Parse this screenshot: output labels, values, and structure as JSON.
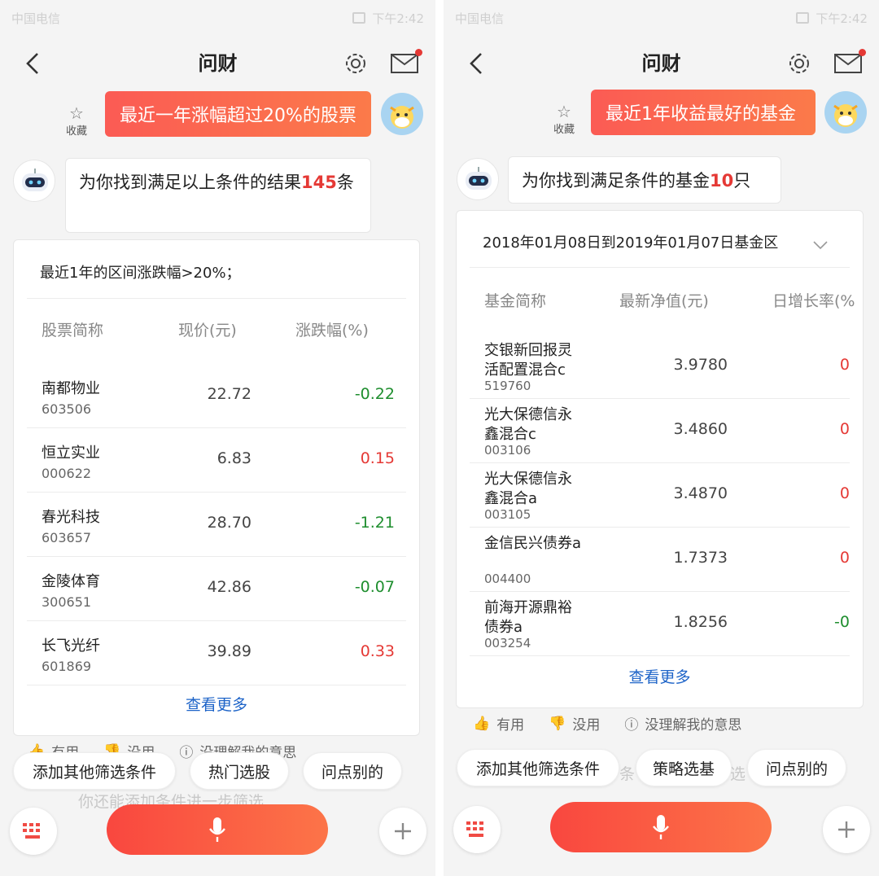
{
  "left": {
    "status": {
      "carrier": "中国电信",
      "time": "下午2:42"
    },
    "title": "问财",
    "favorite_label": "收藏",
    "question": "最近一年涨幅超过20%的股票",
    "answer_prefix": "为你找到满足以上条件的结果",
    "answer_count": "145",
    "answer_suffix": "条",
    "condition": "最近1年的区间涨跌幅>20%；",
    "headers": [
      "股票简称",
      "现价(元)",
      "涨跌幅(%)"
    ],
    "rows": [
      {
        "name": "南都物业",
        "code": "603506",
        "price": "22.72",
        "change": "-0.22",
        "dir": "down"
      },
      {
        "name": "恒立实业",
        "code": "000622",
        "price": "6.83",
        "change": "0.15",
        "dir": "up"
      },
      {
        "name": "春光科技",
        "code": "603657",
        "price": "28.70",
        "change": "-1.21",
        "dir": "down"
      },
      {
        "name": "金陵体育",
        "code": "300651",
        "price": "42.86",
        "change": "-0.07",
        "dir": "down"
      },
      {
        "name": "长飞光纤",
        "code": "601869",
        "price": "39.89",
        "change": "0.33",
        "dir": "up"
      }
    ],
    "more": "查看更多",
    "feedback": [
      "有用",
      "没用",
      "没理解我的意思"
    ],
    "chips": [
      "添加其他筛选条件",
      "热门选股",
      "问点别的"
    ],
    "ghost_hint": "你还能添加条件进一步筛选"
  },
  "right": {
    "status": {
      "carrier": "中国电信",
      "time": "下午2:42"
    },
    "title": "问财",
    "favorite_label": "收藏",
    "question": "最近1年收益最好的基金",
    "answer_prefix": "为你找到满足条件的基金",
    "answer_count": "10",
    "answer_suffix": "只",
    "range": "2018年01月08日到2019年01月07日基金区",
    "headers": [
      "基金简称",
      "最新净值(元)",
      "日增长率(%"
    ],
    "rows": [
      {
        "name": "交银新回报灵活配置混合c",
        "code": "519760",
        "nav": "3.9780",
        "change": "0",
        "dir": "up"
      },
      {
        "name": "光大保德信永鑫混合c",
        "code": "003106",
        "nav": "3.4860",
        "change": "0",
        "dir": "up"
      },
      {
        "name": "光大保德信永鑫混合a",
        "code": "003105",
        "nav": "3.4870",
        "change": "0",
        "dir": "up"
      },
      {
        "name": "金信民兴债券a",
        "code": "004400",
        "nav": "1.7373",
        "change": "0",
        "dir": "up"
      },
      {
        "name": "前海开源鼎裕债券a",
        "code": "003254",
        "nav": "1.8256",
        "change": "-0",
        "dir": "down"
      }
    ],
    "more": "查看更多",
    "feedback": [
      "有用",
      "没用",
      "没理解我的意思"
    ],
    "chips": [
      "添加其他筛选条件",
      "策略选基",
      "问点别的"
    ],
    "ghost_hint_a": "条",
    "ghost_hint_b": "选"
  },
  "colors": {
    "accent": "#fb5b54",
    "up": "#e53935",
    "down": "#1e8e2e",
    "link": "#1e64c8"
  }
}
